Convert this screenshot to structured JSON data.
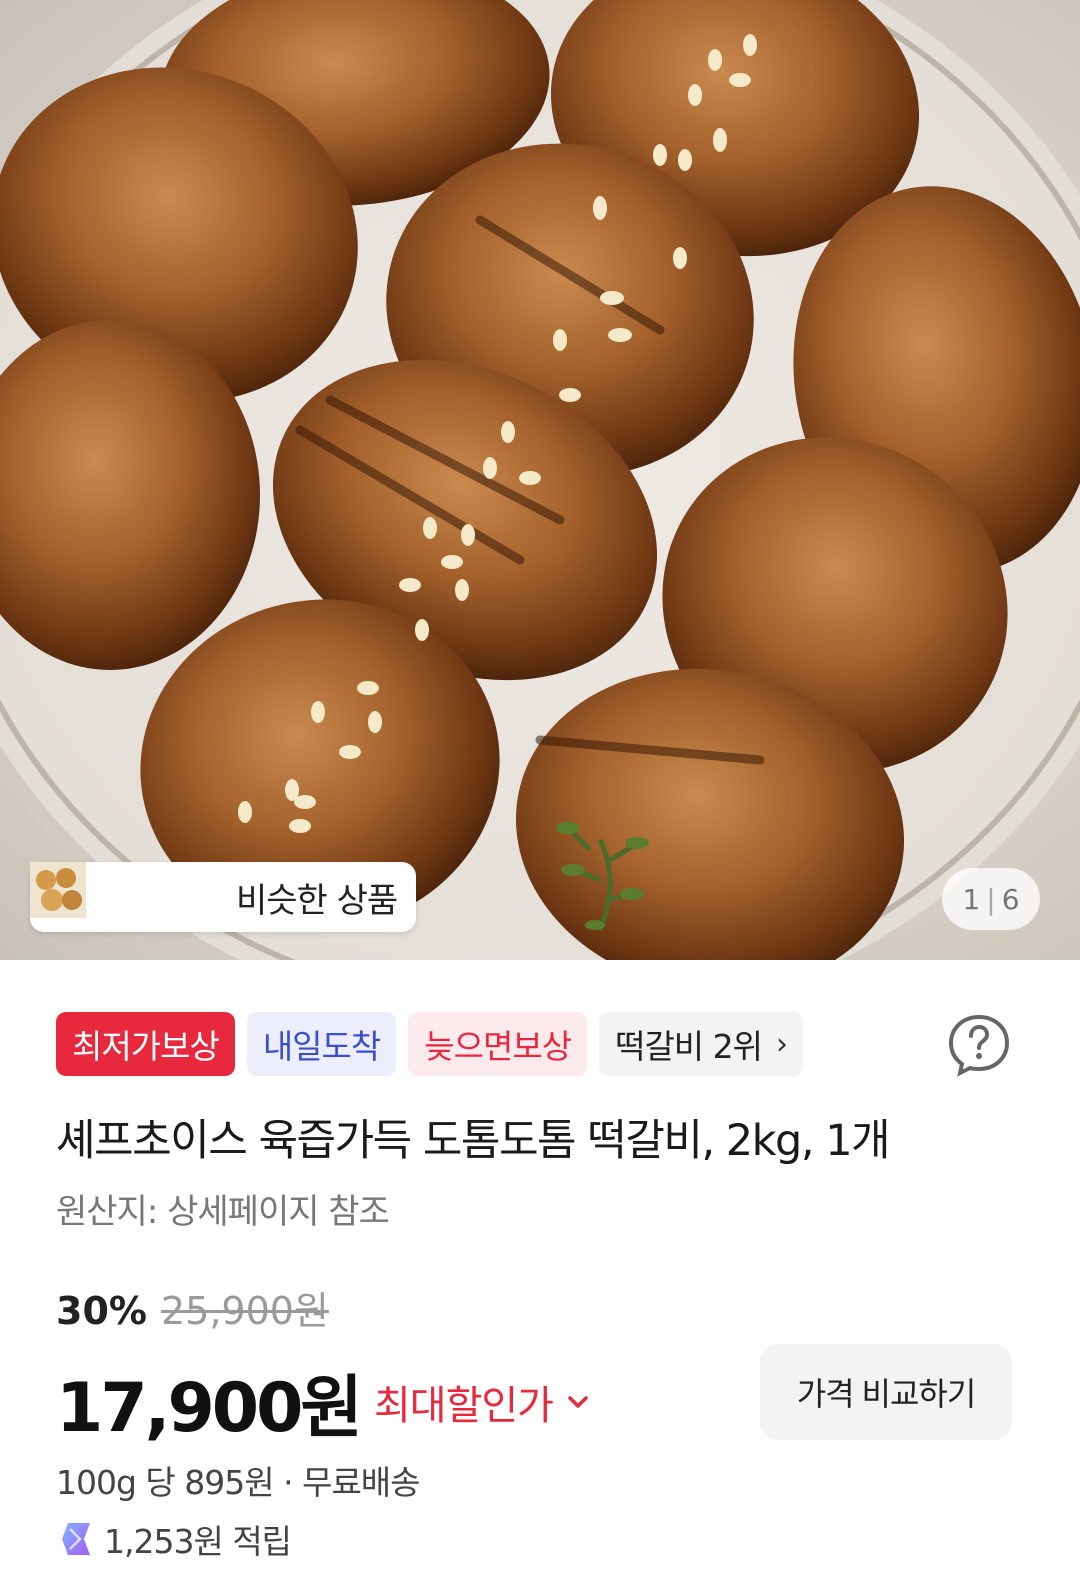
{
  "hero": {
    "similar_label": "비슷한 상품",
    "pager_current": "1",
    "pager_total": "6"
  },
  "badges": [
    {
      "label": "최저가보상"
    },
    {
      "label": "내일도착"
    },
    {
      "label": "늦으면보상"
    },
    {
      "label": "떡갈비 2위"
    }
  ],
  "product": {
    "title": "셰프초이스 육즙가득 도톰도톰 떡갈비, 2kg, 1개",
    "origin": "원산지: 상세페이지 참조"
  },
  "price": {
    "discount_percent": "30%",
    "original_price": "25,900원",
    "sale_price": "17,900원",
    "max_discount_label": "최대할인가",
    "compare_button": "가격 비교하기",
    "unit_price_shipping": "100g 당 895원 · 무료배송",
    "reward_points": "1,253원 적립"
  },
  "colors": {
    "accent_red": "#e8283c",
    "badge_blue_text": "#3a4fd0"
  }
}
